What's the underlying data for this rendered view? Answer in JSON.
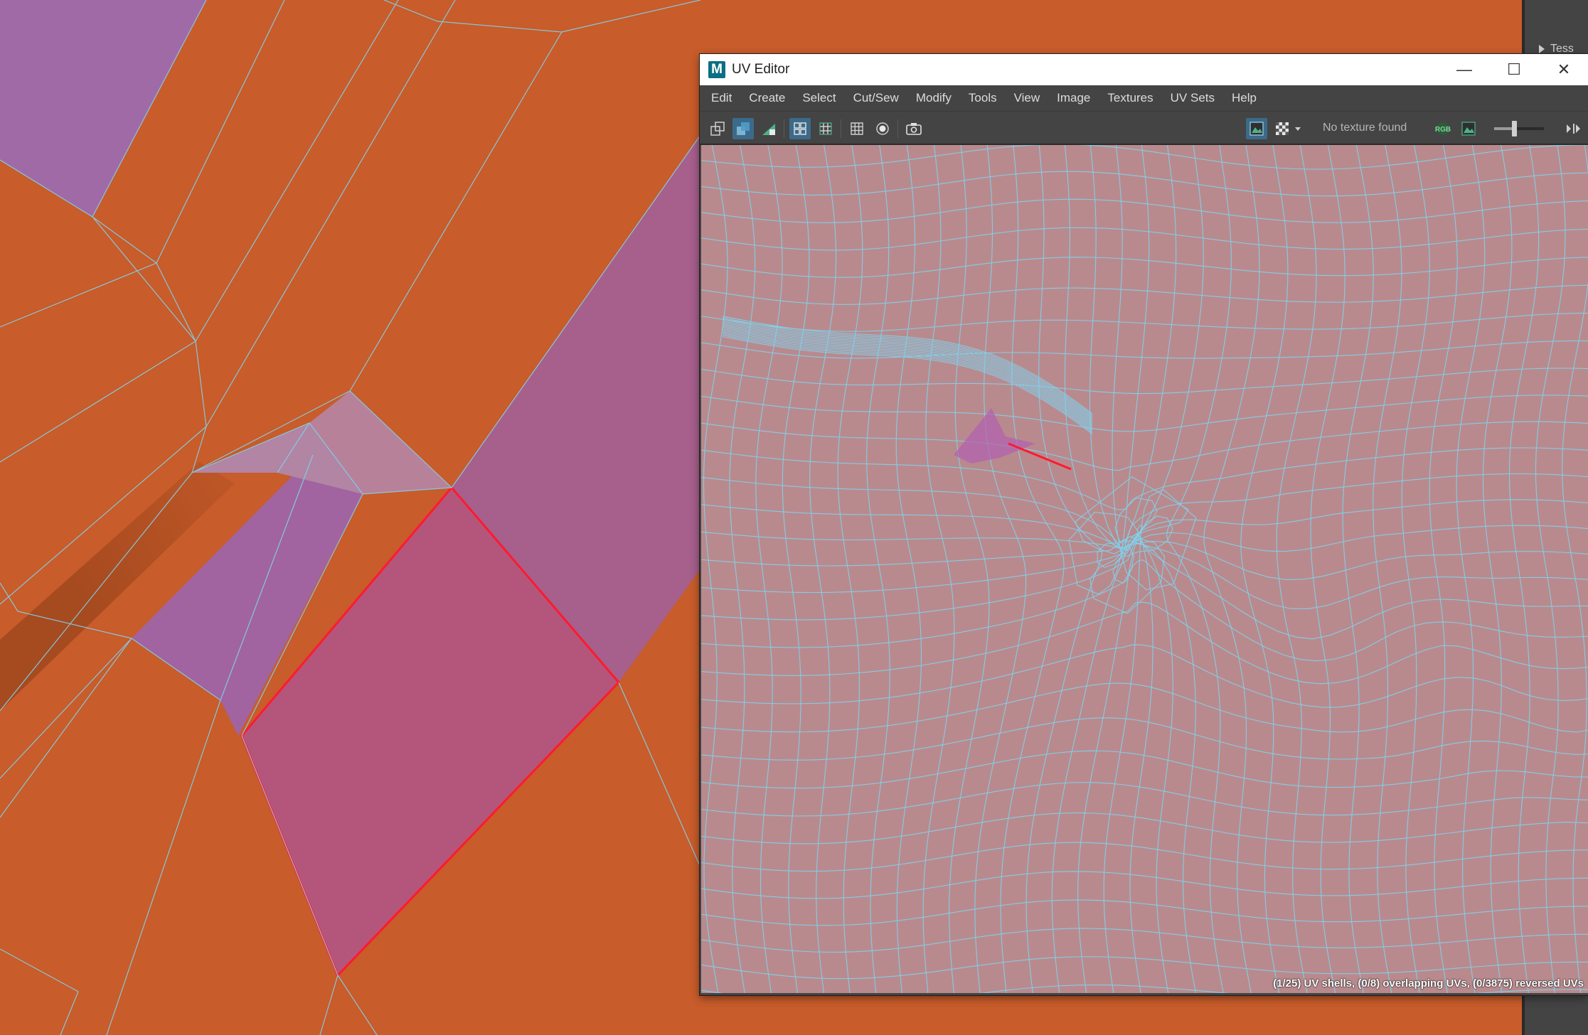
{
  "window": {
    "title": "UV Editor",
    "logo_letter": "M"
  },
  "window_controls": {
    "minimize": "—",
    "maximize": "☐",
    "close": "✕"
  },
  "menus": [
    "Edit",
    "Create",
    "Select",
    "Cut/Sew",
    "Modify",
    "Tools",
    "View",
    "Image",
    "Textures",
    "UV Sets",
    "Help"
  ],
  "toolbar": {
    "texture_status": "No texture found",
    "rgb_label": "RGB"
  },
  "toolbar_icons": [
    "uv-toolkit-icon",
    "shaded-uv-icon",
    "distortion-icon",
    "grid-uv-icon",
    "uv-grid-snap-icon",
    "grid-icon",
    "pixel-snap-icon",
    "snapshot-icon",
    "image-display-icon",
    "checker-icon",
    "dropdown-arrow-icon",
    "rgb-channels-icon",
    "alpha-channel-icon"
  ],
  "exposure": {
    "level": 0.4
  },
  "right_panel": {
    "tab_label": "Tess"
  },
  "status": {
    "text": "(1/25) UV shells, (0/8) overlapping UVs, (0/3875) reversed UVs"
  },
  "colors": {
    "viewport_bg": "#c85c2a",
    "uv_bg": "#b98a8d",
    "wire": "#7fd3ee",
    "selection": "#ff1a2e",
    "purple_face": "#a75f8c"
  }
}
